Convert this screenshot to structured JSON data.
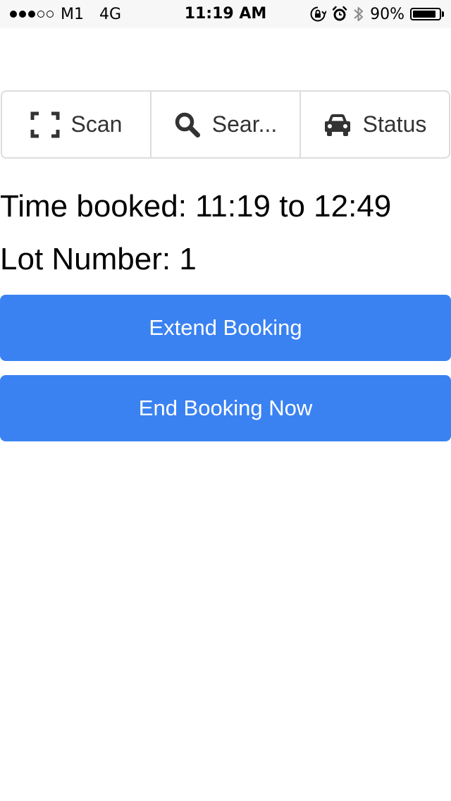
{
  "status_bar": {
    "signal_bars_filled": 3,
    "signal_bars_total": 5,
    "carrier": "M1",
    "network": "4G",
    "time": "11:19 AM",
    "battery_percent_text": "90%",
    "battery_level": 0.9,
    "icons": [
      "rotation-lock-icon",
      "alarm-icon",
      "bluetooth-icon",
      "battery-icon"
    ]
  },
  "nav": {
    "items": [
      {
        "label": "Scan",
        "icon": "scan-frame-icon"
      },
      {
        "label": "Sear...",
        "icon": "search-icon"
      },
      {
        "label": "Status",
        "icon": "car-icon"
      }
    ]
  },
  "booking": {
    "time_booked": "Time booked: 11:19 to 12:49",
    "lot_number": "Lot Number: 1"
  },
  "actions": {
    "extend_label": "Extend Booking",
    "end_label": "End Booking Now"
  },
  "colors": {
    "button_primary": "#3a82f2",
    "button_text": "#ffffff",
    "nav_border": "#dddddd",
    "nav_text": "#333333",
    "status_bar_bg": "#f7f7f7"
  }
}
